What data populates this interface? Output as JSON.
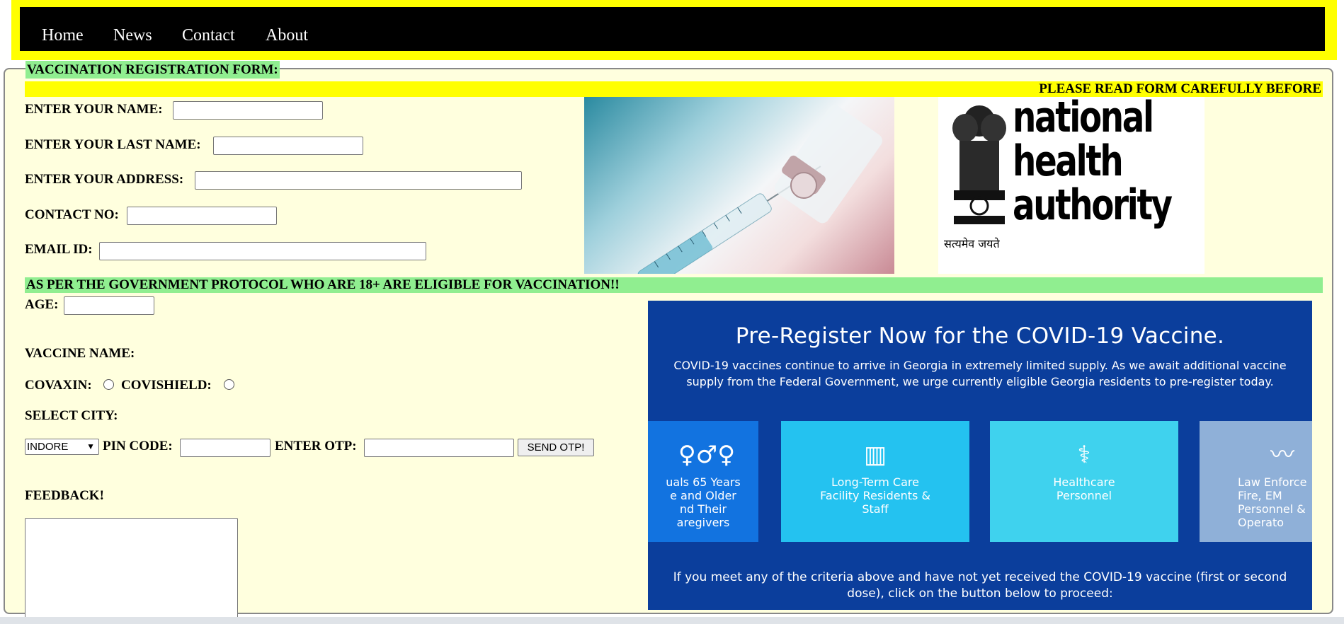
{
  "nav": {
    "items": [
      "Home",
      "News",
      "Contact",
      "About"
    ]
  },
  "form": {
    "legend": "VACCINATION REGISTRATION FORM:",
    "notice": "PLEASE READ FORM CAREFULLY BEFORE",
    "name_label": "ENTER YOUR NAME:",
    "last_name_label": "ENTER YOUR LAST NAME:",
    "address_label": "ENTER YOUR ADDRESS:",
    "contact_label": "CONTACT NO:",
    "email_label": "EMAIL ID:",
    "protocol_notice": "AS PER THE GOVERNMENT PROTOCOL WHO ARE 18+ ARE ELIGIBLE FOR VACCINATION!!",
    "age_label": "AGE:",
    "vaccine_label": "VACCINE NAME:",
    "covaxin_label": "COVAXIN:",
    "covishield_label": "COVISHIELD:",
    "city_label": "SELECT CITY:",
    "city_selected": "INDORE",
    "pin_label": "PIN CODE:",
    "otp_label": "ENTER OTP:",
    "send_otp_label": "SEND OTP!",
    "feedback_label": "FEEDBACK!"
  },
  "logo": {
    "line1": "national",
    "line2": "health",
    "line3": "authority",
    "hindi": "सत्यमेव जयते"
  },
  "poster": {
    "title": "Pre-Register Now for the COVID-19 Vaccine.",
    "subtitle": "COVID-19 vaccines continue to arrive in Georgia in extremely limited supply. As we await additional vaccine supply from the Federal Government, we urge currently eligible Georgia residents to pre-register today.",
    "tiles": [
      "uals 65 Years\ne and Older\nnd Their\naregivers",
      "Long-Term Care\nFacility Residents &\nStaff",
      "Healthcare\nPersonnel",
      "Law Enforce\nFire, EM\nPersonnel &\nOperato"
    ],
    "footer": "If you meet any of the criteria above and have not yet received the COVID-19 vaccine (first or second dose), click on the button below to proceed:",
    "colors": {
      "background": "#0b3e9c",
      "tile1": "#1273e0",
      "tile2": "#24c2f0",
      "tile3": "#3fd2ee",
      "tile4": "#8fb0d8"
    }
  },
  "colors": {
    "topbar": "#ffff00",
    "navbar": "#000000",
    "fieldset_bg": "#ffffde",
    "highlight_green": "#90ee90"
  }
}
